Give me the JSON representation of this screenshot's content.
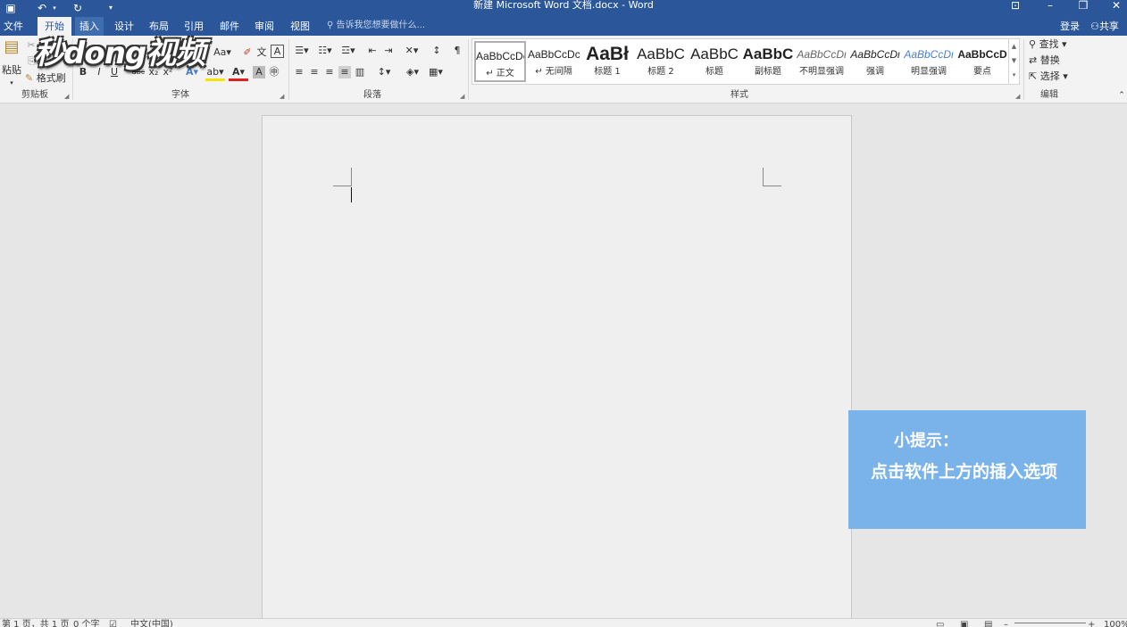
{
  "window": {
    "title": "新建 Microsoft Word 文档.docx - Word",
    "controls": {
      "minimize": "–",
      "restore": "❐",
      "close": "✕",
      "ribbon_options": "⊡"
    }
  },
  "menu": {
    "tabs": [
      "文件",
      "开始",
      "插入",
      "设计",
      "布局",
      "引用",
      "邮件",
      "审阅",
      "视图"
    ],
    "active_tab": "开始",
    "hovered_tab": "插入",
    "tell_me": "告诉我您想要做什么...",
    "login": "登录",
    "share": "共享"
  },
  "ribbon": {
    "clipboard": {
      "paste": "粘贴",
      "format_painter": "格式刷",
      "label": "剪贴板"
    },
    "font": {
      "label": "字体",
      "font_case": "Aa",
      "bold": "B",
      "italic": "I",
      "underline": "U",
      "strike": "abc",
      "subscript": "x₂",
      "superscript": "x²"
    },
    "paragraph": {
      "label": "段落"
    },
    "styles": {
      "label": "样式",
      "items": [
        {
          "preview": "AaBbCcDc",
          "name": "↵ 正文"
        },
        {
          "preview": "AaBbCcDc",
          "name": "↵ 无间隔"
        },
        {
          "preview": "AaBł",
          "name": "标题 1"
        },
        {
          "preview": "AaBbC",
          "name": "标题 2"
        },
        {
          "preview": "AaBbC",
          "name": "标题"
        },
        {
          "preview": "AaBbC",
          "name": "副标题"
        },
        {
          "preview": "AaBbCcDι",
          "name": "不明显强调"
        },
        {
          "preview": "AaBbCcDι",
          "name": "强调"
        },
        {
          "preview": "AaBbCcDι",
          "name": "明显强调"
        },
        {
          "preview": "AaBbCcD",
          "name": "要点"
        }
      ]
    },
    "editing": {
      "label": "编辑",
      "find": "查找",
      "replace": "替换",
      "select": "选择"
    }
  },
  "tip": {
    "title": "小提示：",
    "text": "点击软件上方的插入选项"
  },
  "watermark": "秒dong视频",
  "statusbar": {
    "page": "第 1 页，共 1 页",
    "words": "0 个字",
    "language": "中文(中国)",
    "zoom": "100%"
  },
  "colors": {
    "title_bar": "#2b579a",
    "tip_bg": "#7ab3e9",
    "ribbon_bg": "#f3f3f3",
    "canvas_bg": "#e6e6e6"
  }
}
